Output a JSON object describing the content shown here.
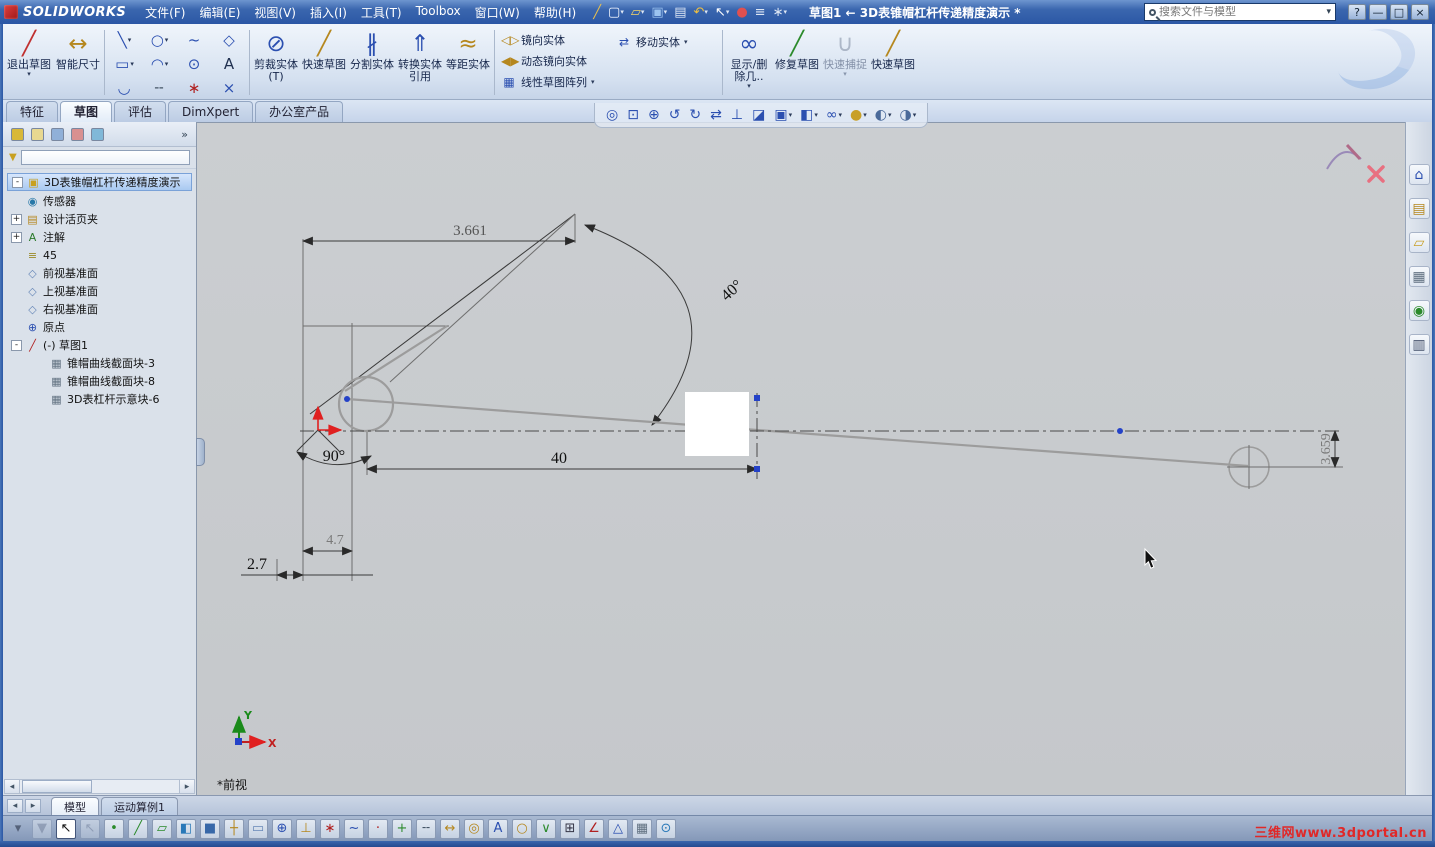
{
  "titlebar": {
    "logo_text": "SOLIDWORKS",
    "menus": [
      {
        "label": "文件(F)"
      },
      {
        "label": "编辑(E)"
      },
      {
        "label": "视图(V)"
      },
      {
        "label": "插入(I)"
      },
      {
        "label": "工具(T)"
      },
      {
        "label": "Toolbox"
      },
      {
        "label": "窗口(W)"
      },
      {
        "label": "帮助(H)"
      }
    ],
    "std_icons": [
      {
        "name": "sketch-quick-icon",
        "glyph": "╱",
        "color": "#e8c050"
      },
      {
        "name": "new-document-icon",
        "glyph": "▢",
        "color": "#f4f8ff",
        "caret": "▾"
      },
      {
        "name": "open-icon",
        "glyph": "▱",
        "color": "#f4d468",
        "caret": "▾"
      },
      {
        "name": "save-icon",
        "glyph": "▣",
        "color": "#9cc4f0",
        "caret": "▾"
      },
      {
        "name": "print-icon",
        "glyph": "▤",
        "color": "#dce6f4"
      },
      {
        "name": "undo-icon",
        "glyph": "↶",
        "color": "#f0c040",
        "caret": "▾"
      },
      {
        "name": "select-arrow-icon",
        "glyph": "↖",
        "color": "#ffffff",
        "caret": "▾"
      },
      {
        "name": "rebuild-icon",
        "glyph": "●",
        "color": "#e05050"
      },
      {
        "name": "file-properties-icon",
        "glyph": "≡",
        "color": "#dce6f4"
      },
      {
        "name": "options-gear-icon",
        "glyph": "∗",
        "color": "#dce6f4",
        "caret": "▾"
      }
    ],
    "doc_title": "草图1 ← 3D表锥帽杠杆传递精度演示 *",
    "search_placeholder": "搜索文件与模型",
    "search_caret": "▾",
    "window_buttons": [
      {
        "name": "help-button",
        "glyph": "?"
      },
      {
        "name": "minimize-button",
        "glyph": "—"
      },
      {
        "name": "restore-button",
        "glyph": "□"
      },
      {
        "name": "close-button",
        "glyph": "×"
      }
    ]
  },
  "command_manager": {
    "exit_sketch": {
      "label": "退出草图",
      "glyph": "╱",
      "caret": "▾"
    },
    "smart_dimension": {
      "label": "智能尺寸",
      "glyph": "↔"
    },
    "entity_tools": [
      {
        "name": "line-tool-icon",
        "glyph": "╲",
        "color": "#2b4fb0",
        "caret": "▾"
      },
      {
        "name": "circle-tool-icon",
        "glyph": "○",
        "color": "#2b4fb0",
        "caret": "▾"
      },
      {
        "name": "spline-tool-icon",
        "glyph": "~",
        "color": "#2b4fb0"
      },
      {
        "name": "polygon-tool-icon",
        "glyph": "◇",
        "color": "#2b4fb0"
      },
      {
        "name": "rectangle-tool-icon",
        "glyph": "▭",
        "color": "#2b4fb0",
        "caret": "▾"
      },
      {
        "name": "arc-tool-icon",
        "glyph": "◠",
        "color": "#2b4fb0",
        "caret": "▾"
      },
      {
        "name": "ellipse-tool-icon",
        "glyph": "⊙",
        "color": "#2b4fb0"
      },
      {
        "name": "text-tool-icon",
        "glyph": "A",
        "color": "#203050"
      },
      {
        "name": "fillet-tool-icon",
        "glyph": "◡",
        "color": "#2b4fb0"
      },
      {
        "name": "centerline-tool-icon",
        "glyph": "╌",
        "color": "#445566"
      },
      {
        "name": "point-tool-icon",
        "glyph": "∗",
        "color": "#b02020"
      },
      {
        "name": "construction-geometry-icon",
        "glyph": "×",
        "color": "#2b4fb0"
      }
    ],
    "big_buttons": [
      {
        "name": "trim-entities-button",
        "label": "剪裁实体(T)",
        "glyph": "⊘",
        "color": "#2b4fb0"
      },
      {
        "name": "rapid-sketch-button",
        "label": "快速草图",
        "glyph": "╱",
        "color": "#b5871e"
      },
      {
        "name": "split-entities-button",
        "label": "分割实体",
        "glyph": "∦",
        "color": "#2b4fb0"
      },
      {
        "name": "convert-entities-button",
        "label": "转换实体引用",
        "glyph": "⇑",
        "color": "#2b4fb0"
      },
      {
        "name": "offset-entities-button",
        "label": "等距实体",
        "glyph": "≈",
        "color": "#b5871e"
      }
    ],
    "mirror_group": [
      {
        "name": "mirror-entities-button",
        "label": "镜向实体",
        "glyph": "◁▷",
        "color": "#b5871e"
      },
      {
        "name": "dynamic-mirror-button",
        "label": "动态镜向实体",
        "glyph": "◀▶",
        "color": "#b5871e"
      },
      {
        "name": "linear-sketch-pattern-button",
        "label": "线性草图阵列",
        "glyph": "▦",
        "color": "#2b4fb0",
        "caret": "▾"
      }
    ],
    "move_entities": {
      "label": "移动实体",
      "glyph": "⇄",
      "caret": "▾"
    },
    "right_buttons": [
      {
        "name": "display-delete-relations-button",
        "label": "显示/删除几..",
        "glyph": "∞",
        "color": "#2b4fb0",
        "caret": "▾"
      },
      {
        "name": "repair-sketch-button",
        "label": "修复草图",
        "glyph": "╱",
        "color": "#2b8a2b"
      },
      {
        "name": "quick-snaps-button",
        "label": "快速捕捉",
        "glyph": "∪",
        "color": "#6a7890",
        "cls": "disabled",
        "caret": "▾"
      },
      {
        "name": "rapid-sketch-button-2",
        "label": "快速草图",
        "glyph": "╱",
        "color": "#b5871e"
      }
    ]
  },
  "ribbon_tabs": [
    {
      "label": "特征",
      "name": "tab-features"
    },
    {
      "label": "草图",
      "name": "tab-sketch",
      "cls": "active"
    },
    {
      "label": "评估",
      "name": "tab-evaluate"
    },
    {
      "label": "DimXpert",
      "name": "tab-dimxpert"
    },
    {
      "label": "办公室产品",
      "name": "tab-office-products"
    }
  ],
  "headsup_icons": [
    {
      "name": "zoom-fit-icon",
      "glyph": "◎",
      "color": "#2b4fb0"
    },
    {
      "name": "zoom-area-icon",
      "glyph": "⊡",
      "color": "#2b4fb0"
    },
    {
      "name": "zoom-in-out-icon",
      "glyph": "⊕",
      "color": "#2b4fb0"
    },
    {
      "name": "previous-view-icon",
      "glyph": "↺",
      "color": "#2b4fb0"
    },
    {
      "name": "rotate-view-icon",
      "glyph": "↻",
      "color": "#2b4fb0"
    },
    {
      "name": "pan-icon",
      "glyph": "⇄",
      "color": "#2b4fb0"
    },
    {
      "name": "normal-to-icon",
      "glyph": "⊥",
      "color": "#2b4fb0"
    },
    {
      "name": "section-view-icon",
      "glyph": "◪",
      "color": "#2b4fb0"
    },
    {
      "name": "view-orientation-icon",
      "glyph": "▣",
      "color": "#2b4fb0",
      "caret": "▾"
    },
    {
      "name": "display-style-icon",
      "glyph": "◧",
      "color": "#2b4fb0",
      "caret": "▾"
    },
    {
      "name": "hide-show-items-icon",
      "glyph": "∞",
      "color": "#2b4fb0",
      "caret": "▾"
    },
    {
      "name": "edit-appearance-icon",
      "glyph": "●",
      "color": "#c8a028",
      "caret": "▾"
    },
    {
      "name": "apply-scene-icon",
      "glyph": "◐",
      "color": "#4a6a9a",
      "caret": "▾"
    },
    {
      "name": "view-settings-icon",
      "glyph": "◑",
      "color": "#4a6a9a",
      "caret": "▾"
    }
  ],
  "left_panel": {
    "manager_tabs": [
      {
        "name": "feature-manager-tab",
        "color": "#d8b838"
      },
      {
        "name": "property-manager-tab",
        "color": "#e8d890"
      },
      {
        "name": "configuration-manager-tab",
        "color": "#90b0d8"
      },
      {
        "name": "dimxpert-manager-tab",
        "color": "#d89090"
      },
      {
        "name": "display-manager-tab",
        "color": "#80b8d8"
      }
    ],
    "chevron": "»",
    "filter_icon": "▼",
    "root_exp": "-",
    "root_glyph": "▣",
    "tree_root": "3D表锥帽杠杆传递精度演示",
    "tree_items": [
      {
        "label": "传感器",
        "icon": "sensors-icon",
        "glyph": "◉",
        "color": "#2878a8",
        "lv": "lv1"
      },
      {
        "label": "设计活页夹",
        "icon": "design-binder-icon",
        "glyph": "▤",
        "color": "#b5871e",
        "lv": "lv1",
        "exp": "+"
      },
      {
        "label": "注解",
        "icon": "annotations-icon",
        "glyph": "A",
        "color": "#2b7a2b",
        "lv": "lv1",
        "exp": "+"
      },
      {
        "label": "45",
        "icon": "material-icon",
        "glyph": "≡",
        "color": "#9a8a28",
        "lv": "lv1"
      },
      {
        "label": "前视基准面",
        "icon": "plane-icon",
        "glyph": "◇",
        "color": "#6888b8",
        "lv": "lv1"
      },
      {
        "label": "上视基准面",
        "icon": "plane-icon",
        "glyph": "◇",
        "color": "#6888b8",
        "lv": "lv1"
      },
      {
        "label": "右视基准面",
        "icon": "plane-icon",
        "glyph": "◇",
        "color": "#6888b8",
        "lv": "lv1"
      },
      {
        "label": "原点",
        "icon": "origin-icon",
        "glyph": "⊕",
        "color": "#2b4fb0",
        "lv": "lv1"
      },
      {
        "label": "(-) 草图1",
        "icon": "sketch-icon",
        "glyph": "╱",
        "color": "#b02020",
        "lv": "lv1",
        "exp": "-"
      },
      {
        "label": "锥帽曲线截面块-3",
        "icon": "block-icon",
        "glyph": "▦",
        "color": "#607080",
        "lv": "lv2"
      },
      {
        "label": "锥帽曲线截面块-8",
        "icon": "block-icon",
        "glyph": "▦",
        "color": "#607080",
        "lv": "lv2"
      },
      {
        "label": "3D表杠杆示意块-6",
        "icon": "block-icon",
        "glyph": "▦",
        "color": "#607080",
        "lv": "lv2"
      }
    ],
    "scroll_left_glyph": "◂",
    "scroll_right_glyph": "▸"
  },
  "sketch": {
    "dims": {
      "d3661": "3.661",
      "a40": "40°",
      "a90": "90°",
      "d40": "40",
      "d47": "4.7",
      "d27": "2.7",
      "d3659": "3.659"
    },
    "axis_x": "X",
    "axis_y": "Y",
    "view_label": "*前视"
  },
  "task_pane_icons": [
    {
      "name": "solidworks-resources-icon",
      "glyph": "⌂",
      "color": "#2b4fb0"
    },
    {
      "name": "design-library-icon",
      "glyph": "▤",
      "color": "#b5871e"
    },
    {
      "name": "file-explorer-icon",
      "glyph": "▱",
      "color": "#c8a028"
    },
    {
      "name": "view-palette-icon",
      "glyph": "▦",
      "color": "#607080"
    },
    {
      "name": "appearances-scenes-icon",
      "glyph": "◉",
      "color": "#2b8a2b"
    },
    {
      "name": "custom-properties-icon",
      "glyph": "▥",
      "color": "#44506a"
    }
  ],
  "motion_controls": [
    {
      "name": "motion-scroll-left-button",
      "glyph": "◂"
    },
    {
      "name": "motion-scroll-right-button",
      "glyph": "▸"
    }
  ],
  "bottom_tabs": [
    {
      "label": "模型",
      "name": "tab-model",
      "cls": "active"
    },
    {
      "label": "运动算例1",
      "name": "tab-motion-study-1"
    }
  ],
  "filter_toolbar_icons": [
    {
      "name": "toolbar-options-icon",
      "glyph": "▾",
      "color": "#55627a",
      "cls": "flat"
    },
    {
      "name": "toggle-filters-icon",
      "glyph": "▼",
      "color": "#8a94a8",
      "cls": "disabled"
    },
    {
      "name": "select-tool-icon",
      "glyph": "↖",
      "color": "#111111",
      "cls": "pressed"
    },
    {
      "name": "clear-all-filters-icon",
      "glyph": "↖",
      "color": "#8a94a8",
      "cls": "disabled"
    },
    {
      "name": "filter-vertices-icon",
      "glyph": "•",
      "color": "#2b8a2b"
    },
    {
      "name": "filter-edges-icon",
      "glyph": "╱",
      "color": "#2b8a2b"
    },
    {
      "name": "filter-faces-icon",
      "glyph": "▱",
      "color": "#2b8a2b"
    },
    {
      "name": "filter-surface-bodies-icon",
      "glyph": "◧",
      "color": "#2878b8"
    },
    {
      "name": "filter-solid-bodies-icon",
      "glyph": "■",
      "color": "#3868a8"
    },
    {
      "name": "filter-axes-icon",
      "glyph": "┼",
      "color": "#b5871e"
    },
    {
      "name": "filter-planes-icon",
      "glyph": "▭",
      "color": "#6888b8"
    },
    {
      "name": "filter-origins-icon",
      "glyph": "⊕",
      "color": "#2b4fb0"
    },
    {
      "name": "filter-coordinate-systems-icon",
      "glyph": "⊥",
      "color": "#b5871e"
    },
    {
      "name": "filter-sketch-points-icon",
      "glyph": "∗",
      "color": "#b02020"
    },
    {
      "name": "filter-sketch-segments-icon",
      "glyph": "~",
      "color": "#2b4fb0"
    },
    {
      "name": "filter-midpoints-icon",
      "glyph": "·",
      "color": "#b02020"
    },
    {
      "name": "filter-center-marks-icon",
      "glyph": "+",
      "color": "#2b8a2b"
    },
    {
      "name": "filter-centerline-icon",
      "glyph": "╌",
      "color": "#445566"
    },
    {
      "name": "filter-dimensions-icon",
      "glyph": "↔",
      "color": "#b5871e"
    },
    {
      "name": "filter-hole-callouts-icon",
      "glyph": "◎",
      "color": "#b5871e"
    },
    {
      "name": "filter-notes-icon",
      "glyph": "A",
      "color": "#2b4fb0"
    },
    {
      "name": "filter-balloons-icon",
      "glyph": "○",
      "color": "#b5871e"
    },
    {
      "name": "filter-surface-finish-icon",
      "glyph": "∨",
      "color": "#2b8a2b"
    },
    {
      "name": "filter-geometric-tolerances-icon",
      "glyph": "⊞",
      "color": "#333344"
    },
    {
      "name": "filter-weld-symbols-icon",
      "glyph": "∠",
      "color": "#b02020"
    },
    {
      "name": "filter-datum-features-icon",
      "glyph": "△",
      "color": "#2b4fb0"
    },
    {
      "name": "filter-blocks-icon",
      "glyph": "▦",
      "color": "#607080"
    },
    {
      "name": "filter-routing-points-icon",
      "glyph": "⊙",
      "color": "#2878b8"
    }
  ],
  "watermark": "三维网www.3dportal.cn"
}
